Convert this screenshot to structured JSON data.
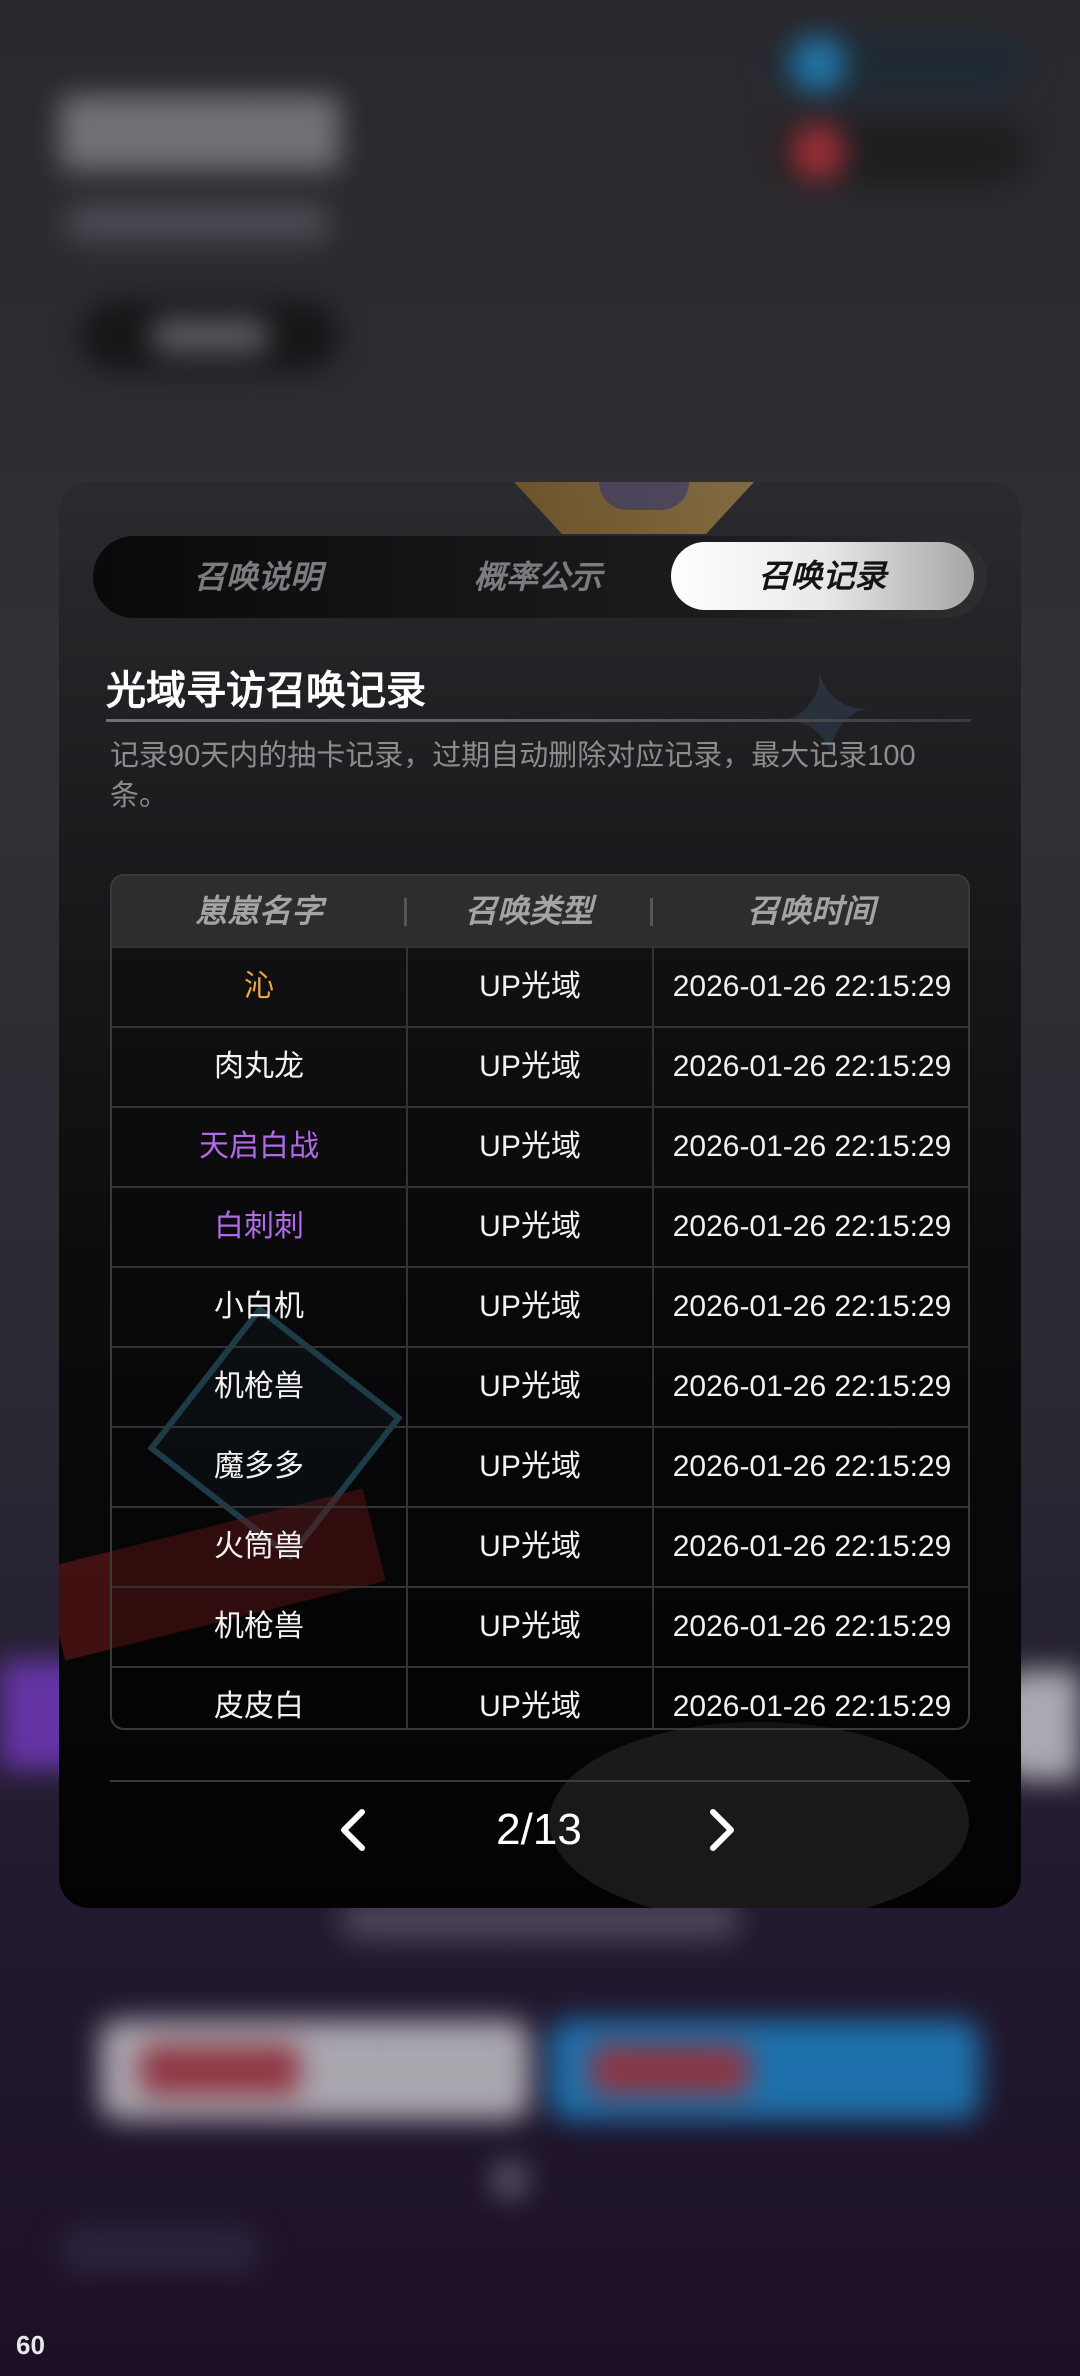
{
  "colors": {
    "rarity_orange": "#f0a43a",
    "rarity_purple": "#b06ae6",
    "rarity_normal": "#f2f2f2"
  },
  "status_bar": {
    "fps": "60"
  },
  "tabs": [
    {
      "label": "召唤说明",
      "active": false
    },
    {
      "label": "概率公示",
      "active": false
    },
    {
      "label": "召唤记录",
      "active": true
    }
  ],
  "record": {
    "title": "光域寻访召唤记录",
    "description": "记录90天内的抽卡记录，过期自动删除对应记录，最大记录100条。",
    "columns": [
      "崽崽名字",
      "召唤类型",
      "召唤时间"
    ],
    "rows": [
      {
        "name": "沁",
        "type": "UP光域",
        "time": "2026-01-26 22:15:29",
        "rarity": "orange"
      },
      {
        "name": "肉丸龙",
        "type": "UP光域",
        "time": "2026-01-26 22:15:29",
        "rarity": "normal"
      },
      {
        "name": "天启白战",
        "type": "UP光域",
        "time": "2026-01-26 22:15:29",
        "rarity": "purple"
      },
      {
        "name": "白刺刺",
        "type": "UP光域",
        "time": "2026-01-26 22:15:29",
        "rarity": "purple"
      },
      {
        "name": "小白机",
        "type": "UP光域",
        "time": "2026-01-26 22:15:29",
        "rarity": "normal"
      },
      {
        "name": "机枪兽",
        "type": "UP光域",
        "time": "2026-01-26 22:15:29",
        "rarity": "normal"
      },
      {
        "name": "魔多多",
        "type": "UP光域",
        "time": "2026-01-26 22:15:29",
        "rarity": "normal"
      },
      {
        "name": "火筒兽",
        "type": "UP光域",
        "time": "2026-01-26 22:15:29",
        "rarity": "normal"
      },
      {
        "name": "机枪兽",
        "type": "UP光域",
        "time": "2026-01-26 22:15:29",
        "rarity": "normal"
      },
      {
        "name": "皮皮白",
        "type": "UP光域",
        "time": "2026-01-26 22:15:29",
        "rarity": "normal"
      }
    ]
  },
  "pager": {
    "label": "2/13",
    "prev_icon": "chevron-left-icon",
    "next_icon": "chevron-right-icon"
  }
}
